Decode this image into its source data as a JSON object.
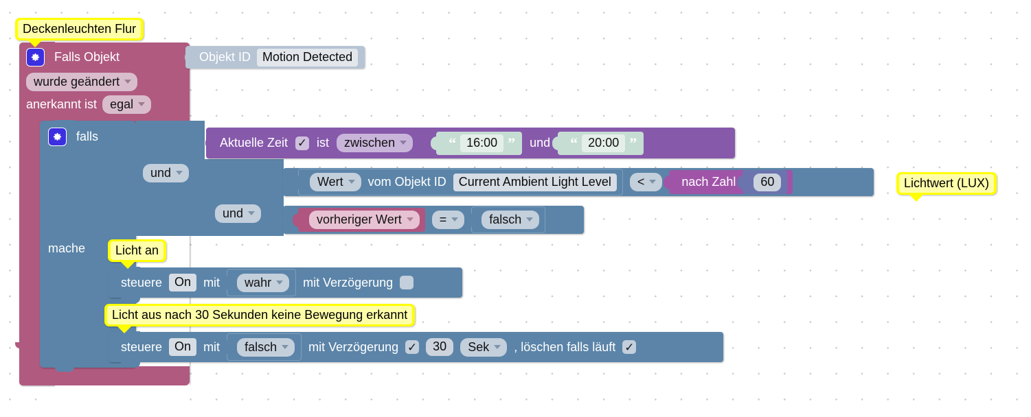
{
  "editor": {
    "type": "blockly-visual-script",
    "background": "#ffffff",
    "grid_color": "#c9c9c9"
  },
  "notes": {
    "title": "Deckenleuchten Flur",
    "lux": "Lichtwert (LUX)",
    "light_on": "Licht an",
    "light_off": "Licht aus nach 30 Sekunden keine Bewegung erkannt"
  },
  "trigger": {
    "gear_icon": "gear-icon",
    "label": "Falls Objekt",
    "object_id_label": "Objekt ID",
    "object_id_value": "Motion Detected",
    "change_mode": "wurde geändert",
    "ack_label": "anerkannt ist",
    "ack_value": "egal",
    "color": "#b05a80"
  },
  "if_block": {
    "gear_icon": "gear-icon",
    "label": "falls",
    "do_label": "mache",
    "color": "#5b84a8",
    "operators": {
      "and1": "und",
      "and2": "und"
    }
  },
  "condition_time": {
    "label": "Aktuelle Zeit",
    "checkbox": "✓",
    "is_label": "ist",
    "mode": "zwischen",
    "from": "16:00",
    "conjunction": "und",
    "to": "20:00",
    "color": "#8659ab"
  },
  "condition_value": {
    "get_mode": "Wert",
    "from_label": "vom Objekt ID",
    "object_id": "Current Ambient Light Level",
    "operator": "<",
    "convert_label": "nach Zahl",
    "number": "60",
    "color": "#5b84a8",
    "convert_color": "#a054a8",
    "number_color": "#6b74ae"
  },
  "condition_previous": {
    "source": "vorheriger Wert",
    "operator": "=",
    "value": "falsch",
    "color": "#b0557f"
  },
  "actions": [
    {
      "verb": "steuere",
      "target": "On",
      "with_label": "mit",
      "value": "wahr",
      "delay_label": "mit Verzögerung",
      "delay_checked": false,
      "delay_check_glyph": "",
      "delay_value": "",
      "delay_unit": "",
      "clear_label": "",
      "clear_checked": false
    },
    {
      "verb": "steuere",
      "target": "On",
      "with_label": "mit",
      "value": "falsch",
      "delay_label": "mit Verzögerung",
      "delay_checked": true,
      "delay_check_glyph": "✓",
      "delay_value": "30",
      "delay_unit": "Sek",
      "clear_label": ", löschen falls läuft",
      "clear_checked": true,
      "clear_check_glyph": "✓"
    }
  ]
}
